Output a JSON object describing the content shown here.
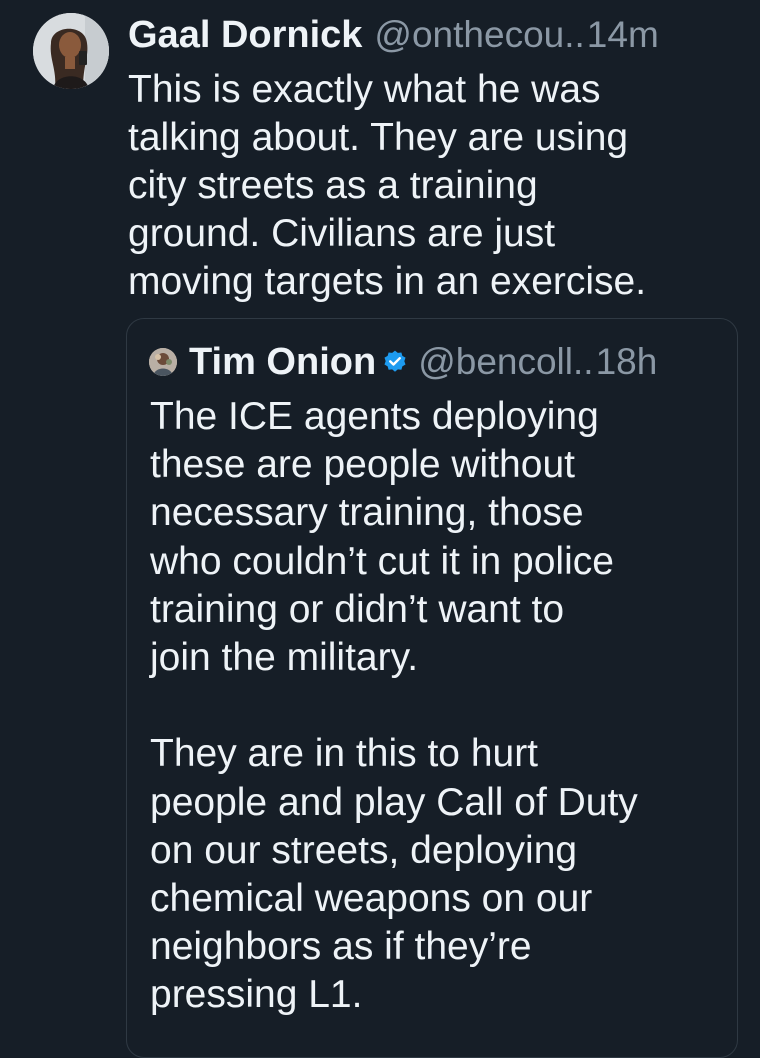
{
  "post": {
    "author": {
      "display_name": "Gaal Dornick",
      "handle": "@onthecou..",
      "avatar_icon": "user-avatar-photo"
    },
    "time": "14m",
    "text": "This is exactly what he was\ntalking about. They are using\ncity streets as a training\nground. Civilians are just\nmoving targets in an exercise.",
    "quoted": {
      "author": {
        "display_name": "Tim Onion",
        "handle": "@bencoll..",
        "verified": true,
        "avatar_icon": "user-avatar-small"
      },
      "time": "18h",
      "text": "The ICE agents deploying\nthese are people without\nnecessary training, those\nwho couldn’t cut it in police\ntraining or didn’t want to\njoin the military.\n\nThey are in this to hurt\npeople and play Call of Duty\non our streets, deploying\nchemical weapons on our\nneighbors as if they’re\npressing L1."
    }
  },
  "colors": {
    "background": "#161e27",
    "text_primary": "#eef3f7",
    "text_secondary": "#8b98a5",
    "quote_border": "#2f3943",
    "verified_badge": "#1d9bf0"
  }
}
